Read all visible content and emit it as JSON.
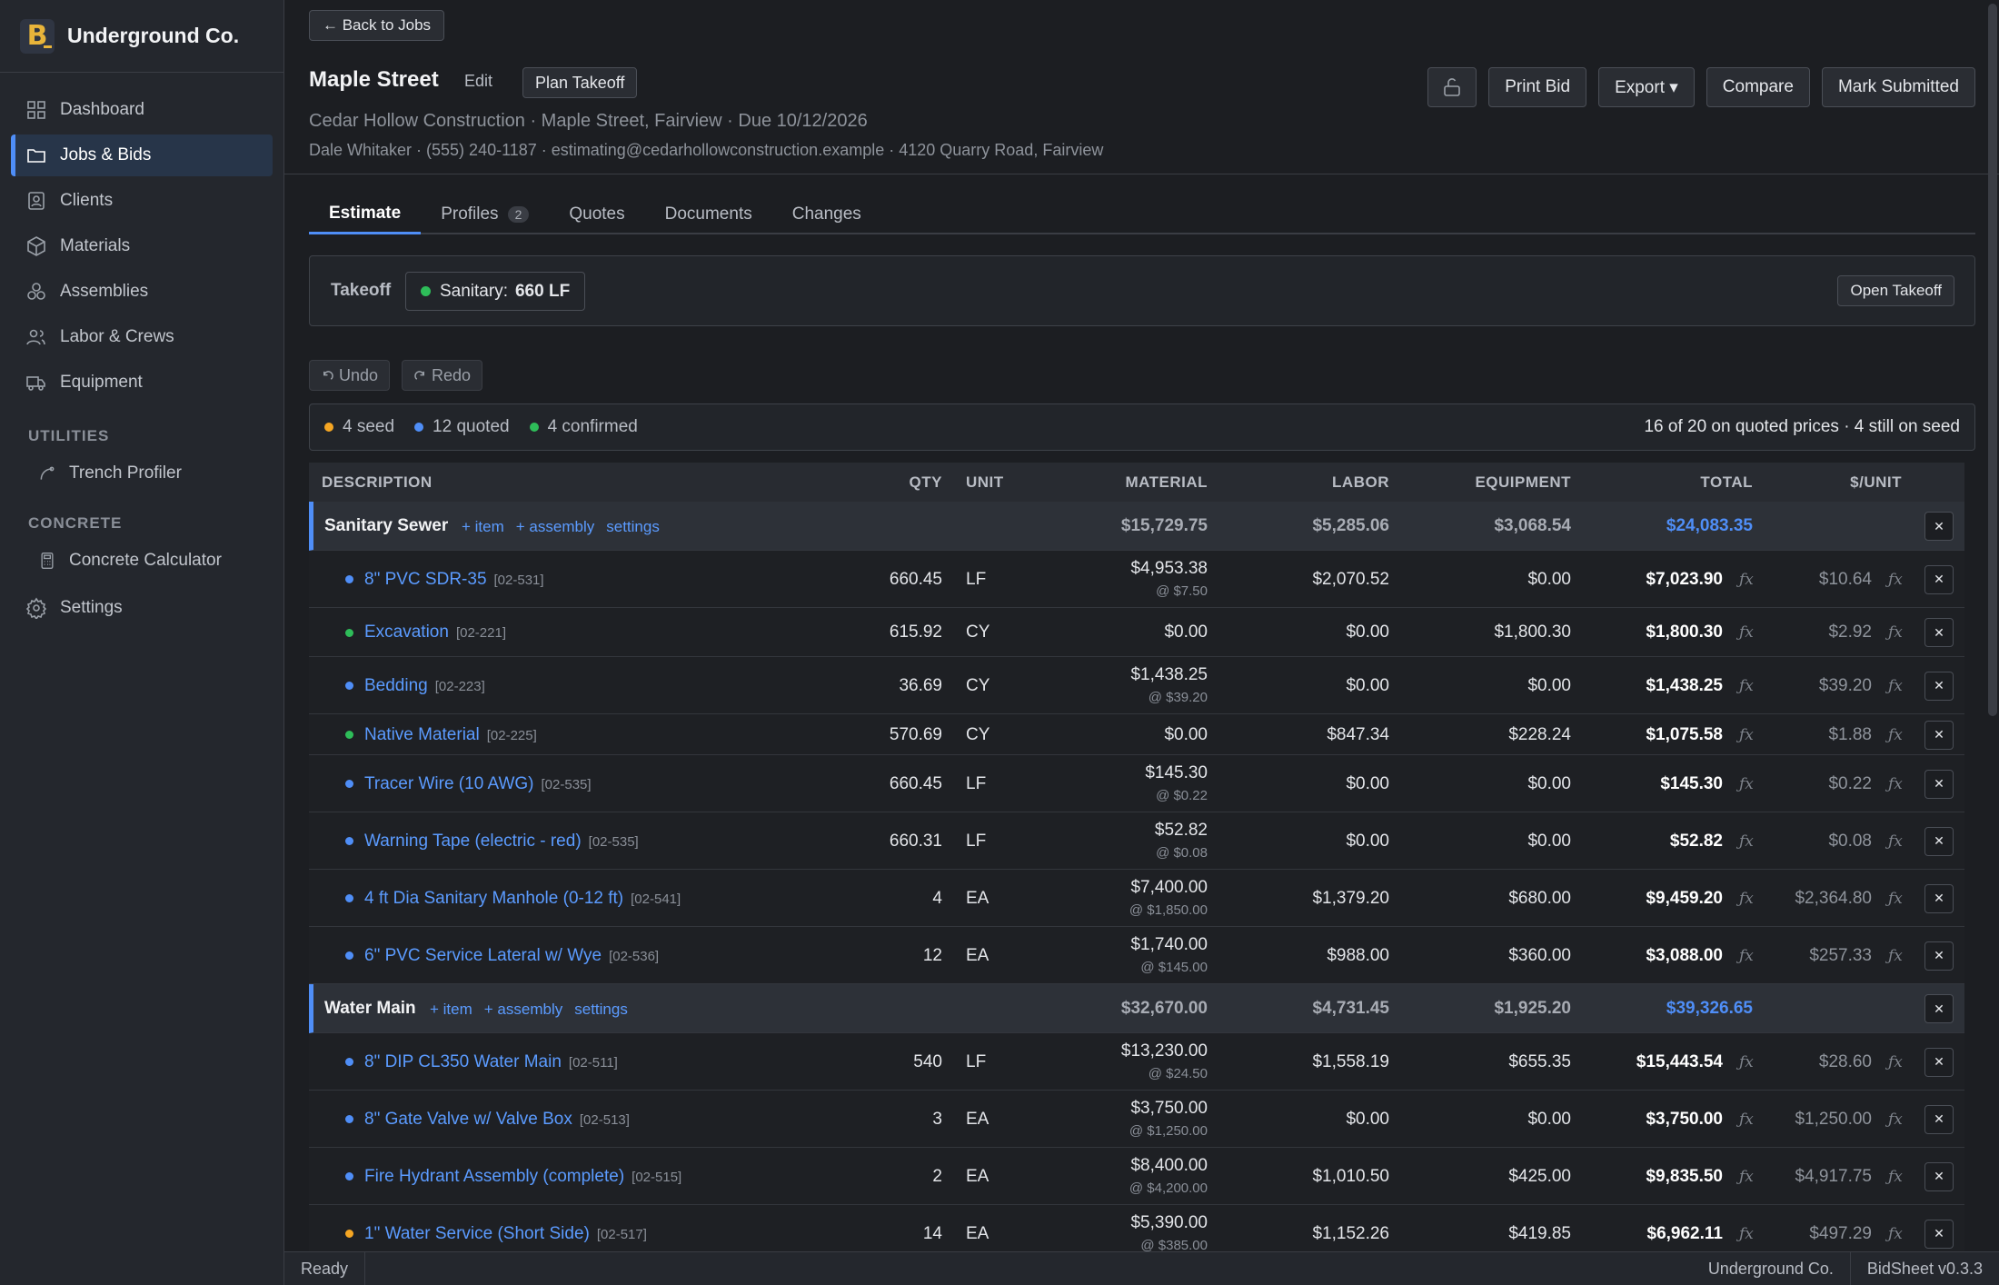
{
  "brand": {
    "name": "Underground Co.",
    "logo_letter": "B"
  },
  "nav": {
    "items": [
      {
        "label": "Dashboard",
        "icon": "grid-icon"
      },
      {
        "label": "Jobs & Bids",
        "icon": "folder-icon",
        "active": true
      },
      {
        "label": "Clients",
        "icon": "contact-icon"
      },
      {
        "label": "Materials",
        "icon": "cube-icon"
      },
      {
        "label": "Assemblies",
        "icon": "assembly-icon"
      },
      {
        "label": "Labor & Crews",
        "icon": "users-icon"
      },
      {
        "label": "Equipment",
        "icon": "truck-icon"
      }
    ],
    "utilities_heading": "UTILITIES",
    "trench_profiler": "Trench Profiler",
    "concrete_heading": "CONCRETE",
    "concrete_calculator": "Concrete Calculator",
    "settings": "Settings"
  },
  "header": {
    "back": "← Back to Jobs",
    "title": "Maple Street",
    "edit": "Edit",
    "plan_takeoff": "Plan Takeoff",
    "subtitle": "Cedar Hollow Construction · Maple Street, Fairview · Due 10/12/2026",
    "contact": "Dale Whitaker · (555) 240-1187 · estimating@cedarhollowconstruction.example · 4120 Quarry Road, Fairview",
    "actions": {
      "print": "Print Bid",
      "export": "Export ▾",
      "compare": "Compare",
      "submit": "Mark Submitted"
    }
  },
  "tabs": {
    "estimate": "Estimate",
    "profiles": "Profiles",
    "profiles_count": "2",
    "quotes": "Quotes",
    "documents": "Documents",
    "changes": "Changes"
  },
  "takeoff": {
    "label": "Takeoff",
    "chip_label": "Sanitary:",
    "chip_value": "660 LF",
    "open": "Open Takeoff"
  },
  "history": {
    "undo": "Undo",
    "redo": "Redo"
  },
  "status": {
    "seed": "4 seed",
    "quoted": "12 quoted",
    "confirmed": "4 confirmed",
    "summary": "16 of 20 on quoted prices · 4 still on seed"
  },
  "colors": {
    "seed": "#f5a623",
    "quoted": "#4f8ef7",
    "confirmed": "#2ebd59"
  },
  "columns": {
    "description": "DESCRIPTION",
    "qty": "QTY",
    "unit": "UNIT",
    "material": "MATERIAL",
    "labor": "LABOR",
    "equipment": "EQUIPMENT",
    "total": "TOTAL",
    "per_unit": "$/UNIT"
  },
  "group_links": {
    "item": "+ item",
    "assembly": "+ assembly",
    "settings": "settings"
  },
  "groups": [
    {
      "name": "Sanitary Sewer",
      "material": "$15,729.75",
      "labor": "$5,285.06",
      "equipment": "$3,068.54",
      "total": "$24,083.35",
      "items": [
        {
          "name": "8\" PVC SDR-35",
          "code": "[02-531]",
          "status": "quoted",
          "qty": "660.45",
          "unit": "LF",
          "material": "$4,953.38",
          "rate": "@ $7.50",
          "labor": "$2,070.52",
          "equipment": "$0.00",
          "total": "$7,023.90",
          "per_unit": "$10.64"
        },
        {
          "name": "Excavation",
          "code": "[02-221]",
          "status": "confirmed",
          "qty": "615.92",
          "unit": "CY",
          "material": "$0.00",
          "rate": "",
          "labor": "$0.00",
          "equipment": "$1,800.30",
          "total": "$1,800.30",
          "per_unit": "$2.92"
        },
        {
          "name": "Bedding",
          "code": "[02-223]",
          "status": "quoted",
          "qty": "36.69",
          "unit": "CY",
          "material": "$1,438.25",
          "rate": "@ $39.20",
          "labor": "$0.00",
          "equipment": "$0.00",
          "total": "$1,438.25",
          "per_unit": "$39.20"
        },
        {
          "name": "Native Material",
          "code": "[02-225]",
          "status": "confirmed",
          "qty": "570.69",
          "unit": "CY",
          "material": "$0.00",
          "rate": "",
          "labor": "$847.34",
          "equipment": "$228.24",
          "total": "$1,075.58",
          "per_unit": "$1.88"
        },
        {
          "name": "Tracer Wire (10 AWG)",
          "code": "[02-535]",
          "status": "quoted",
          "qty": "660.45",
          "unit": "LF",
          "material": "$145.30",
          "rate": "@ $0.22",
          "labor": "$0.00",
          "equipment": "$0.00",
          "total": "$145.30",
          "per_unit": "$0.22"
        },
        {
          "name": "Warning Tape (electric - red)",
          "code": "[02-535]",
          "status": "quoted",
          "qty": "660.31",
          "unit": "LF",
          "material": "$52.82",
          "rate": "@ $0.08",
          "labor": "$0.00",
          "equipment": "$0.00",
          "total": "$52.82",
          "per_unit": "$0.08"
        },
        {
          "name": "4 ft Dia Sanitary Manhole (0-12 ft)",
          "code": "[02-541]",
          "status": "quoted",
          "qty": "4",
          "unit": "EA",
          "material": "$7,400.00",
          "rate": "@ $1,850.00",
          "labor": "$1,379.20",
          "equipment": "$680.00",
          "total": "$9,459.20",
          "per_unit": "$2,364.80"
        },
        {
          "name": "6\" PVC Service Lateral w/ Wye",
          "code": "[02-536]",
          "status": "quoted",
          "qty": "12",
          "unit": "EA",
          "material": "$1,740.00",
          "rate": "@ $145.00",
          "labor": "$988.00",
          "equipment": "$360.00",
          "total": "$3,088.00",
          "per_unit": "$257.33"
        }
      ]
    },
    {
      "name": "Water Main",
      "material": "$32,670.00",
      "labor": "$4,731.45",
      "equipment": "$1,925.20",
      "total": "$39,326.65",
      "items": [
        {
          "name": "8\" DIP CL350 Water Main",
          "code": "[02-511]",
          "status": "quoted",
          "qty": "540",
          "unit": "LF",
          "material": "$13,230.00",
          "rate": "@ $24.50",
          "labor": "$1,558.19",
          "equipment": "$655.35",
          "total": "$15,443.54",
          "per_unit": "$28.60"
        },
        {
          "name": "8\" Gate Valve w/ Valve Box",
          "code": "[02-513]",
          "status": "quoted",
          "qty": "3",
          "unit": "EA",
          "material": "$3,750.00",
          "rate": "@ $1,250.00",
          "labor": "$0.00",
          "equipment": "$0.00",
          "total": "$3,750.00",
          "per_unit": "$1,250.00"
        },
        {
          "name": "Fire Hydrant Assembly (complete)",
          "code": "[02-515]",
          "status": "quoted",
          "qty": "2",
          "unit": "EA",
          "material": "$8,400.00",
          "rate": "@ $4,200.00",
          "labor": "$1,010.50",
          "equipment": "$425.00",
          "total": "$9,835.50",
          "per_unit": "$4,917.75"
        },
        {
          "name": "1\" Water Service (Short Side)",
          "code": "[02-517]",
          "status": "seed",
          "qty": "14",
          "unit": "EA",
          "material": "$5,390.00",
          "rate": "@ $385.00",
          "labor": "$1,152.26",
          "equipment": "$419.85",
          "total": "$6,962.11",
          "per_unit": "$497.29"
        }
      ]
    }
  ],
  "footer": {
    "status": "Ready",
    "company": "Underground Co.",
    "version": "BidSheet v0.3.3"
  }
}
